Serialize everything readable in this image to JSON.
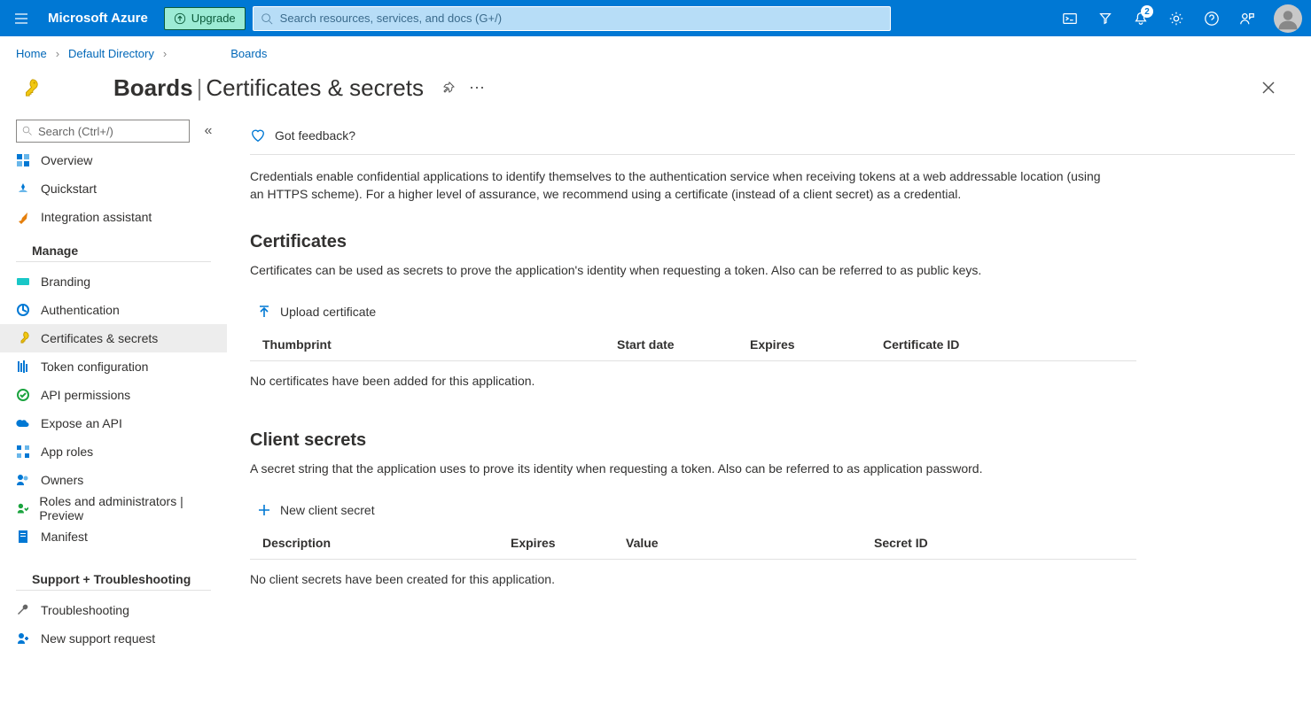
{
  "top": {
    "brand": "Microsoft Azure",
    "upgrade": "Upgrade",
    "search_placeholder": "Search resources, services, and docs (G+/)",
    "notif_count": "2"
  },
  "breadcrumb": {
    "home": "Home",
    "dir": "Default Directory",
    "app": "Boards"
  },
  "page": {
    "app": "Boards",
    "section": "Certificates & secrets"
  },
  "sidebar": {
    "search_placeholder": "Search (Ctrl+/)",
    "items_top": [
      {
        "label": "Overview"
      },
      {
        "label": "Quickstart"
      },
      {
        "label": "Integration assistant"
      }
    ],
    "manage_label": "Manage",
    "items_manage": [
      {
        "label": "Branding"
      },
      {
        "label": "Authentication"
      },
      {
        "label": "Certificates & secrets"
      },
      {
        "label": "Token configuration"
      },
      {
        "label": "API permissions"
      },
      {
        "label": "Expose an API"
      },
      {
        "label": "App roles"
      },
      {
        "label": "Owners"
      },
      {
        "label": "Roles and administrators | Preview"
      },
      {
        "label": "Manifest"
      }
    ],
    "support_label": "Support + Troubleshooting",
    "items_support": [
      {
        "label": "Troubleshooting"
      },
      {
        "label": "New support request"
      }
    ]
  },
  "main": {
    "feedback": "Got feedback?",
    "intro": "Credentials enable confidential applications to identify themselves to the authentication service when receiving tokens at a web addressable location (using an HTTPS scheme). For a higher level of assurance, we recommend using a certificate (instead of a client secret) as a credential.",
    "certs_heading": "Certificates",
    "certs_desc": "Certificates can be used as secrets to prove the application's identity when requesting a token. Also can be referred to as public keys.",
    "upload_cert": "Upload certificate",
    "cert_cols": {
      "c1": "Thumbprint",
      "c2": "Start date",
      "c3": "Expires",
      "c4": "Certificate ID"
    },
    "certs_empty": "No certificates have been added for this application.",
    "secrets_heading": "Client secrets",
    "secrets_desc": "A secret string that the application uses to prove its identity when requesting a token. Also can be referred to as application password.",
    "new_secret": "New client secret",
    "secret_cols": {
      "c1": "Description",
      "c2": "Expires",
      "c3": "Value",
      "c4": "Secret ID"
    },
    "secrets_empty": "No client secrets have been created for this application."
  }
}
